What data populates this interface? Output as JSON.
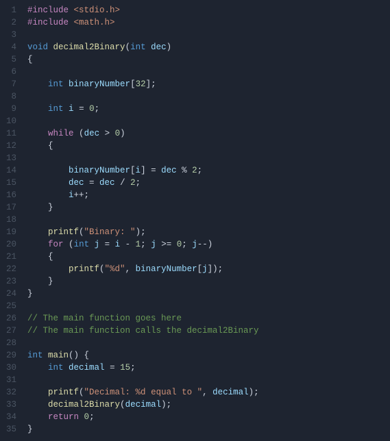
{
  "editor": {
    "lines": [
      {
        "num": 1,
        "tokens": [
          [
            "preproc",
            "#include"
          ],
          [
            "op",
            " "
          ],
          [
            "include-path",
            "<stdio.h>"
          ]
        ]
      },
      {
        "num": 2,
        "tokens": [
          [
            "preproc",
            "#include"
          ],
          [
            "op",
            " "
          ],
          [
            "include-path",
            "<math.h>"
          ]
        ]
      },
      {
        "num": 3,
        "tokens": []
      },
      {
        "num": 4,
        "tokens": [
          [
            "type",
            "void"
          ],
          [
            "op",
            " "
          ],
          [
            "func",
            "decimal2Binary"
          ],
          [
            "punc",
            "("
          ],
          [
            "type",
            "int"
          ],
          [
            "op",
            " "
          ],
          [
            "var",
            "dec"
          ],
          [
            "punc",
            ")"
          ]
        ]
      },
      {
        "num": 5,
        "tokens": [
          [
            "punc",
            "{"
          ]
        ]
      },
      {
        "num": 6,
        "tokens": []
      },
      {
        "num": 7,
        "tokens": [
          [
            "op",
            "    "
          ],
          [
            "type",
            "int"
          ],
          [
            "op",
            " "
          ],
          [
            "var",
            "binaryNumber"
          ],
          [
            "punc",
            "["
          ],
          [
            "num",
            "32"
          ],
          [
            "punc",
            "];"
          ]
        ]
      },
      {
        "num": 8,
        "tokens": []
      },
      {
        "num": 9,
        "tokens": [
          [
            "op",
            "    "
          ],
          [
            "type",
            "int"
          ],
          [
            "op",
            " "
          ],
          [
            "var",
            "i"
          ],
          [
            "op",
            " = "
          ],
          [
            "num",
            "0"
          ],
          [
            "punc",
            ";"
          ]
        ]
      },
      {
        "num": 10,
        "tokens": []
      },
      {
        "num": 11,
        "tokens": [
          [
            "op",
            "    "
          ],
          [
            "control",
            "while"
          ],
          [
            "op",
            " "
          ],
          [
            "punc",
            "("
          ],
          [
            "var",
            "dec"
          ],
          [
            "op",
            " > "
          ],
          [
            "num",
            "0"
          ],
          [
            "punc",
            ")"
          ]
        ]
      },
      {
        "num": 12,
        "tokens": [
          [
            "op",
            "    "
          ],
          [
            "punc",
            "{"
          ]
        ]
      },
      {
        "num": 13,
        "tokens": []
      },
      {
        "num": 14,
        "tokens": [
          [
            "op",
            "        "
          ],
          [
            "var",
            "binaryNumber"
          ],
          [
            "punc",
            "["
          ],
          [
            "var",
            "i"
          ],
          [
            "punc",
            "]"
          ],
          [
            "op",
            " = "
          ],
          [
            "var",
            "dec"
          ],
          [
            "op",
            " % "
          ],
          [
            "num",
            "2"
          ],
          [
            "punc",
            ";"
          ]
        ]
      },
      {
        "num": 15,
        "tokens": [
          [
            "op",
            "        "
          ],
          [
            "var",
            "dec"
          ],
          [
            "op",
            " = "
          ],
          [
            "var",
            "dec"
          ],
          [
            "op",
            " / "
          ],
          [
            "num",
            "2"
          ],
          [
            "punc",
            ";"
          ]
        ]
      },
      {
        "num": 16,
        "tokens": [
          [
            "op",
            "        "
          ],
          [
            "var",
            "i"
          ],
          [
            "op",
            "++"
          ],
          [
            "punc",
            ";"
          ]
        ]
      },
      {
        "num": 17,
        "tokens": [
          [
            "op",
            "    "
          ],
          [
            "punc",
            "}"
          ]
        ]
      },
      {
        "num": 18,
        "tokens": []
      },
      {
        "num": 19,
        "tokens": [
          [
            "op",
            "    "
          ],
          [
            "func",
            "printf"
          ],
          [
            "punc",
            "("
          ],
          [
            "str",
            "\"Binary: \""
          ],
          [
            "punc",
            ");"
          ]
        ]
      },
      {
        "num": 20,
        "tokens": [
          [
            "op",
            "    "
          ],
          [
            "control",
            "for"
          ],
          [
            "op",
            " "
          ],
          [
            "punc",
            "("
          ],
          [
            "type",
            "int"
          ],
          [
            "op",
            " "
          ],
          [
            "var",
            "j"
          ],
          [
            "op",
            " = "
          ],
          [
            "var",
            "i"
          ],
          [
            "op",
            " - "
          ],
          [
            "num",
            "1"
          ],
          [
            "punc",
            "; "
          ],
          [
            "var",
            "j"
          ],
          [
            "op",
            " >= "
          ],
          [
            "num",
            "0"
          ],
          [
            "punc",
            "; "
          ],
          [
            "var",
            "j"
          ],
          [
            "op",
            "--"
          ],
          [
            "punc",
            ")"
          ]
        ]
      },
      {
        "num": 21,
        "tokens": [
          [
            "op",
            "    "
          ],
          [
            "punc",
            "{"
          ]
        ]
      },
      {
        "num": 22,
        "tokens": [
          [
            "op",
            "        "
          ],
          [
            "func",
            "printf"
          ],
          [
            "punc",
            "("
          ],
          [
            "str",
            "\"%d\""
          ],
          [
            "punc",
            ", "
          ],
          [
            "var",
            "binaryNumber"
          ],
          [
            "punc",
            "["
          ],
          [
            "var",
            "j"
          ],
          [
            "punc",
            "]);"
          ]
        ]
      },
      {
        "num": 23,
        "tokens": [
          [
            "op",
            "    "
          ],
          [
            "punc",
            "}"
          ]
        ]
      },
      {
        "num": 24,
        "tokens": [
          [
            "punc",
            "}"
          ]
        ]
      },
      {
        "num": 25,
        "tokens": []
      },
      {
        "num": 26,
        "tokens": [
          [
            "comment",
            "// The main function goes here"
          ]
        ]
      },
      {
        "num": 27,
        "tokens": [
          [
            "comment",
            "// The main function calls the decimal2Binary"
          ]
        ]
      },
      {
        "num": 28,
        "tokens": []
      },
      {
        "num": 29,
        "tokens": [
          [
            "type",
            "int"
          ],
          [
            "op",
            " "
          ],
          [
            "func",
            "main"
          ],
          [
            "punc",
            "() {"
          ]
        ]
      },
      {
        "num": 30,
        "tokens": [
          [
            "op",
            "    "
          ],
          [
            "type",
            "int"
          ],
          [
            "op",
            " "
          ],
          [
            "var",
            "decimal"
          ],
          [
            "op",
            " = "
          ],
          [
            "num",
            "15"
          ],
          [
            "punc",
            ";"
          ]
        ]
      },
      {
        "num": 31,
        "tokens": []
      },
      {
        "num": 32,
        "tokens": [
          [
            "op",
            "    "
          ],
          [
            "func",
            "printf"
          ],
          [
            "punc",
            "("
          ],
          [
            "str",
            "\"Decimal: %d equal to \""
          ],
          [
            "punc",
            ", "
          ],
          [
            "var",
            "decimal"
          ],
          [
            "punc",
            ");"
          ]
        ]
      },
      {
        "num": 33,
        "tokens": [
          [
            "op",
            "    "
          ],
          [
            "func",
            "decimal2Binary"
          ],
          [
            "punc",
            "("
          ],
          [
            "var",
            "decimal"
          ],
          [
            "punc",
            ");"
          ]
        ]
      },
      {
        "num": 34,
        "tokens": [
          [
            "op",
            "    "
          ],
          [
            "control",
            "return"
          ],
          [
            "op",
            " "
          ],
          [
            "num",
            "0"
          ],
          [
            "punc",
            ";"
          ]
        ]
      },
      {
        "num": 35,
        "tokens": [
          [
            "punc",
            "}"
          ]
        ]
      }
    ]
  }
}
